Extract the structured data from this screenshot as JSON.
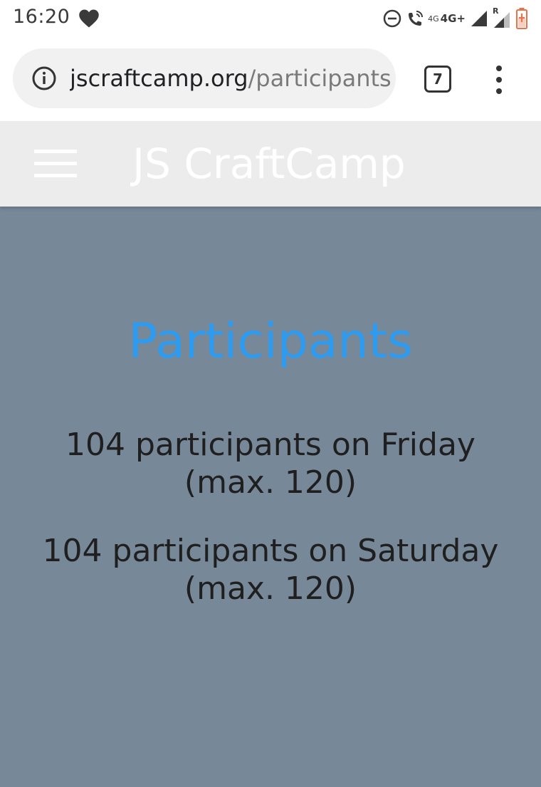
{
  "status_bar": {
    "time": "16:20",
    "network_small": "4G",
    "network": "4G+",
    "roaming": "R",
    "icons": [
      "heart-icon",
      "do-not-disturb-icon",
      "wifi-call-icon",
      "signal-icon",
      "signal-roaming-icon",
      "battery-charging-icon"
    ]
  },
  "browser": {
    "url_domain": "jscraftcamp.org",
    "url_path": "/participants.",
    "tab_count": "7"
  },
  "header": {
    "title": "JS CraftCamp"
  },
  "main": {
    "heading": "Participants",
    "friday_line1": "104 participants on Friday",
    "friday_line2": "(max. 120)",
    "saturday_line1": "104 participants on Saturday",
    "saturday_line2": "(max. 120)"
  },
  "colors": {
    "header_bg": "#ececec",
    "main_bg": "#778899",
    "heading": "#2d9bf0",
    "battery": "#e8734a"
  }
}
